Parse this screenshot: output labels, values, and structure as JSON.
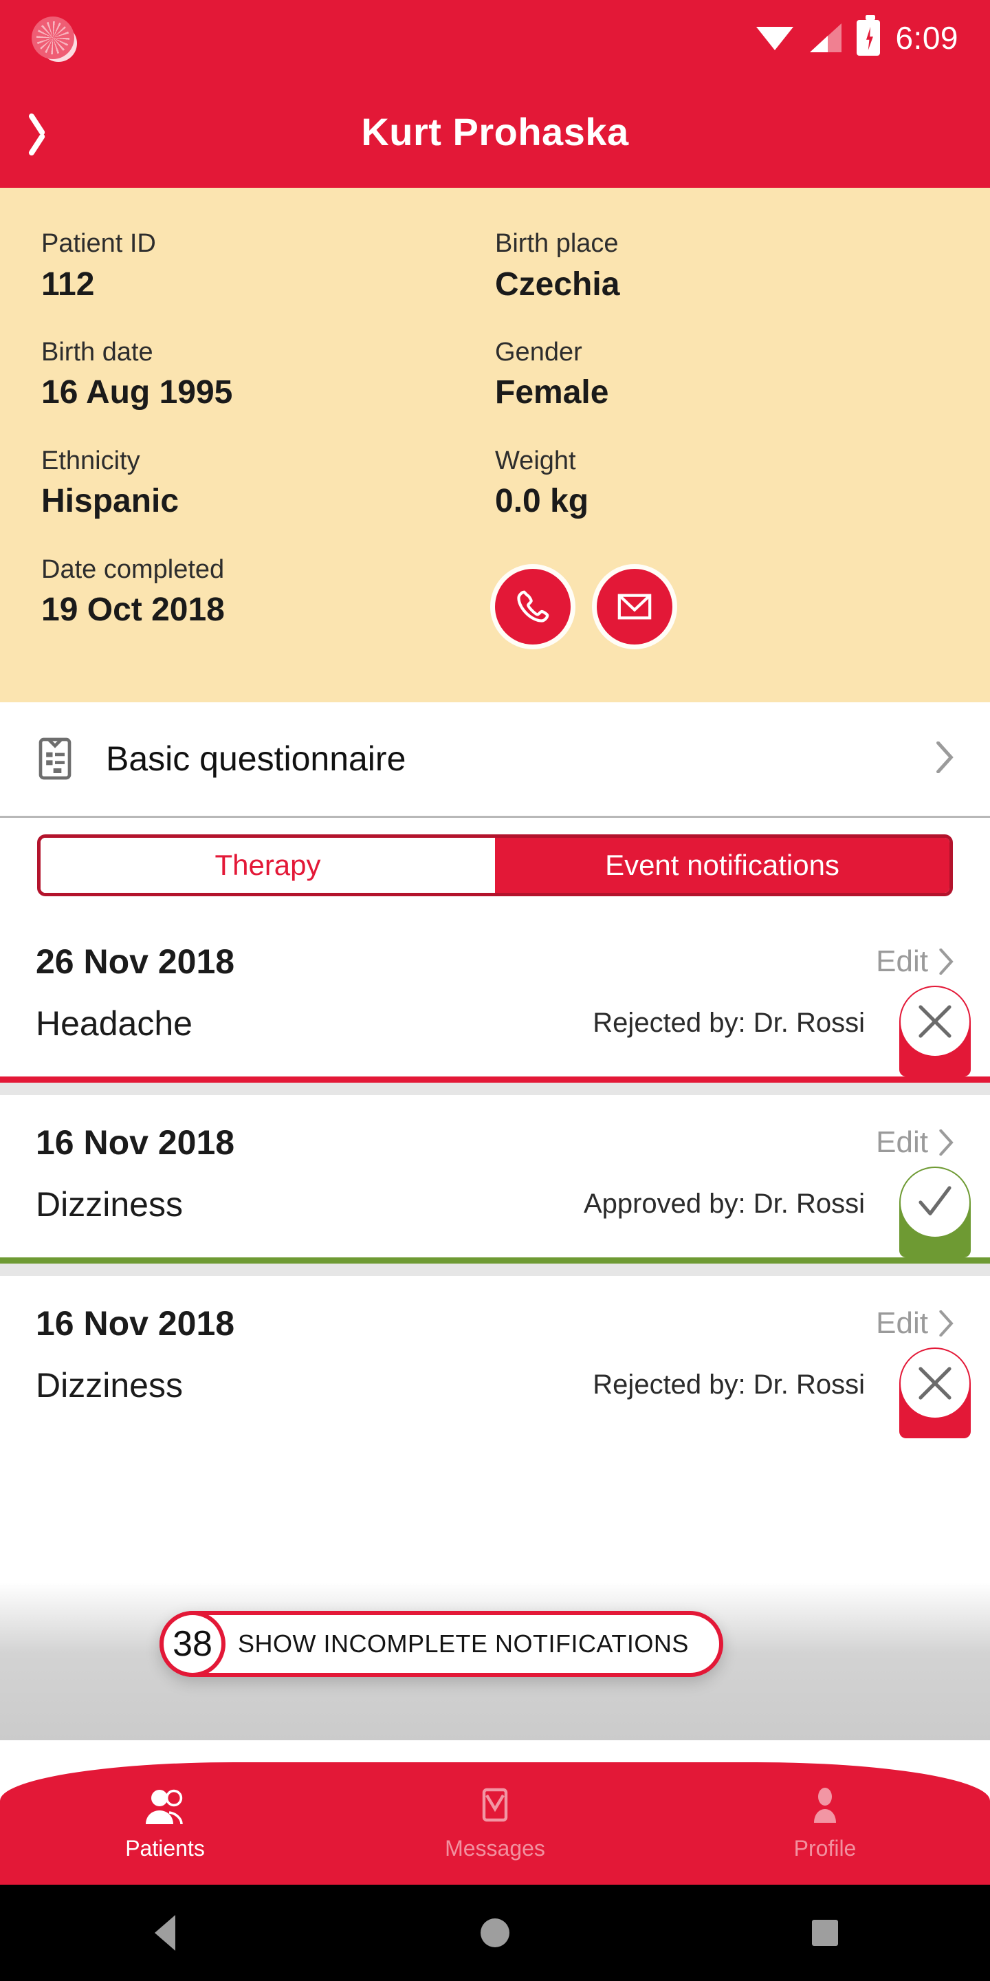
{
  "status_bar": {
    "time": "6:09",
    "icons": [
      "notification-dot-icon",
      "wifi-icon",
      "signal-icon",
      "battery-charging-icon"
    ]
  },
  "app_bar": {
    "back_icon": "chevron-left-icon",
    "title": "Kurt Prohaska"
  },
  "patient": {
    "fields": [
      {
        "label": "Patient ID",
        "value": "112"
      },
      {
        "label": "Birth place",
        "value": "Czechia"
      },
      {
        "label": "Birth date",
        "value": "16 Aug 1995"
      },
      {
        "label": "Gender",
        "value": "Female"
      },
      {
        "label": "Ethnicity",
        "value": "Hispanic"
      },
      {
        "label": "Weight",
        "value": "0.0 kg"
      },
      {
        "label": "Date completed",
        "value": "19 Oct 2018"
      }
    ],
    "actions": [
      {
        "name": "call-button",
        "icon": "phone-icon"
      },
      {
        "name": "email-button",
        "icon": "envelope-icon"
      }
    ],
    "background_color": "#FBE4B0"
  },
  "questionnaire": {
    "icon": "clipboard-icon",
    "label": "Basic questionnaire",
    "chevron": "chevron-right-icon"
  },
  "tabs": {
    "items": [
      {
        "label": "Therapy",
        "active": false
      },
      {
        "label": "Event notifications",
        "active": true
      }
    ]
  },
  "notifications": {
    "edit_label": "Edit",
    "items": [
      {
        "date": "26 Nov 2018",
        "title": "Headache",
        "status_text": "Rejected by: Dr. Rossi",
        "status": "rejected",
        "status_icon": "close-x-icon"
      },
      {
        "date": "16 Nov 2018",
        "title": "Dizziness",
        "status_text": "Approved by: Dr. Rossi",
        "status": "approved",
        "status_icon": "check-icon"
      },
      {
        "date": "16 Nov 2018",
        "title": "Dizziness",
        "status_text": "Rejected by: Dr. Rossi",
        "status": "rejected",
        "status_icon": "close-x-icon"
      }
    ]
  },
  "floating_action": {
    "count": "38",
    "label": "SHOW INCOMPLETE NOTIFICATIONS"
  },
  "bottom_nav": {
    "items": [
      {
        "label": "Patients",
        "icon": "people-icon",
        "active": true
      },
      {
        "label": "Messages",
        "icon": "envelope-icon",
        "active": false
      },
      {
        "label": "Profile",
        "icon": "person-icon",
        "active": false
      }
    ]
  },
  "android_nav": {
    "back": "triangle-back-icon",
    "home": "circle-home-icon",
    "recents": "square-recents-icon"
  },
  "colors": {
    "brand_red": "#E31837",
    "card_yellow": "#FBE4B0",
    "approved_green": "#6E9A33",
    "rejected_red": "#E31837"
  }
}
